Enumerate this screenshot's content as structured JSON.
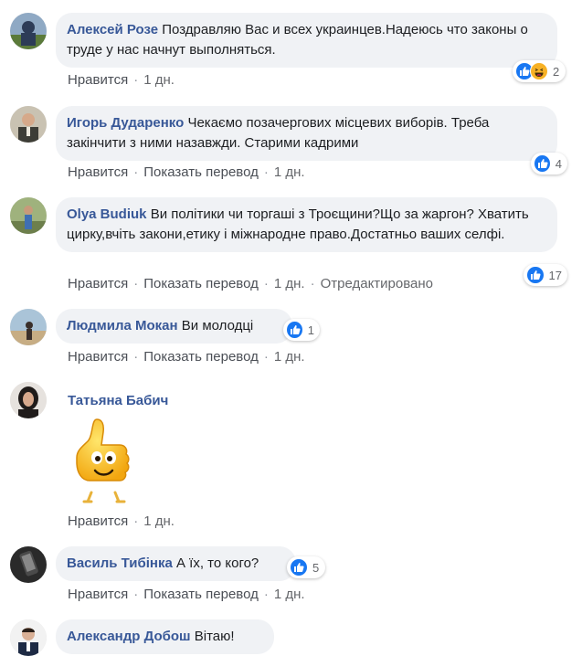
{
  "comments": [
    {
      "author": "Алексей Розе",
      "text": "Поздравляю Вас и всех украинцев.Надеюсь что законы о труде у нас начнут выполняться.",
      "actions": [
        "Нравится"
      ],
      "time": "1 дн.",
      "reactions": [
        "like-icon",
        "haha-icon"
      ],
      "reaction_count": "2"
    },
    {
      "author": "Игорь Дударенко",
      "text": "Чекаємо позачергових місцевих виборів. Треба закінчити з ними назавжди. Старими кадрими",
      "actions": [
        "Нравится",
        "Показать перевод"
      ],
      "time": "1 дн.",
      "reactions": [
        "like-icon"
      ],
      "reaction_count": "4"
    },
    {
      "author": "Olya Budiuk",
      "text": "Ви політики чи торгаші з Троєщини?Що за жаргон? Хватить цирку,вчіть закони,етику і міжнародне право.Достатньо ваших селфі.",
      "actions": [
        "Нравится",
        "Показать перевод"
      ],
      "time": "1 дн.",
      "extra": "Отредактировано",
      "reactions": [
        "like-icon"
      ],
      "reaction_count": "17"
    },
    {
      "author": "Людмила Мокан",
      "text": "Ви молодці",
      "actions": [
        "Нравится",
        "Показать перевод"
      ],
      "time": "1 дн.",
      "reactions": [
        "like-icon"
      ],
      "reaction_count": "1"
    },
    {
      "author": "Татьяна Бабич",
      "sticker": "thumbs-up-sticker",
      "actions": [
        "Нравится"
      ],
      "time": "1 дн."
    },
    {
      "author": "Василь Тибінка",
      "text": "А їх, то кого?",
      "actions": [
        "Нравится",
        "Показать перевод"
      ],
      "time": "1 дн.",
      "reactions": [
        "like-icon"
      ],
      "reaction_count": "5"
    },
    {
      "author": "Александр Добош",
      "text": "Вітаю!"
    }
  ],
  "colors": {
    "author": "#385898",
    "bubble": "#f0f2f5",
    "like": "#1877f2",
    "haha": "#f7b125",
    "meta": "#65676b"
  }
}
